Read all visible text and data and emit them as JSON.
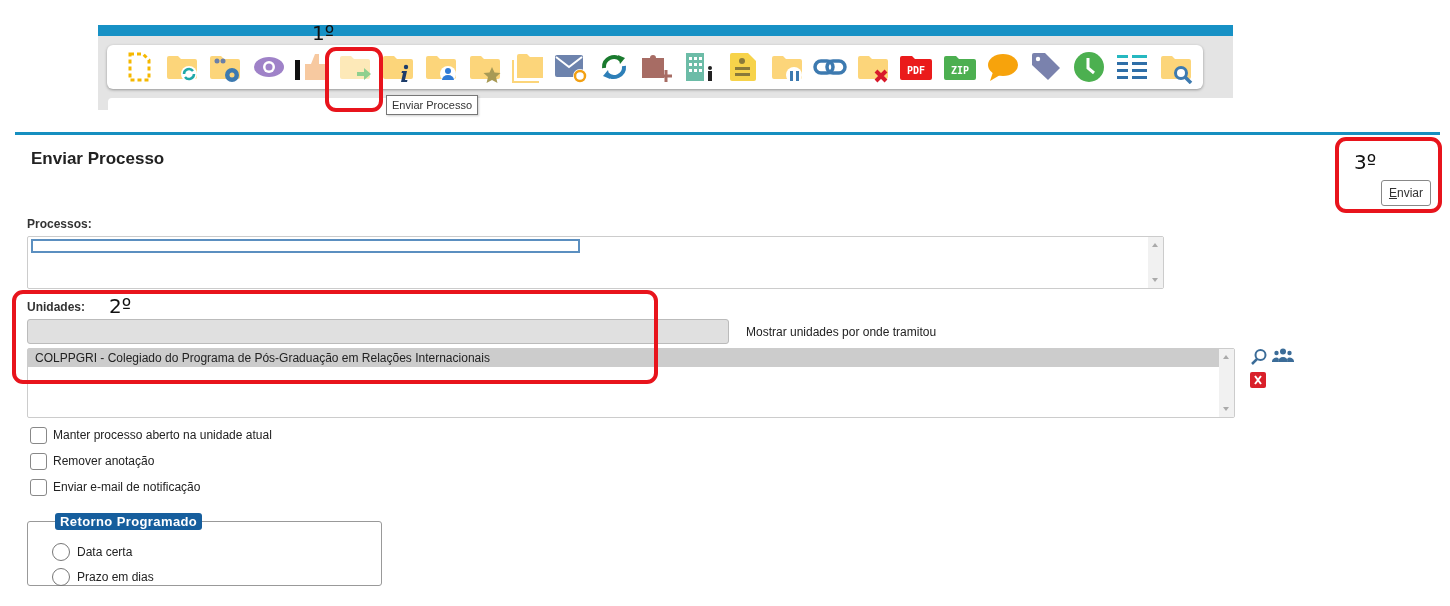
{
  "toolbar": {
    "pdf_label": "PDF",
    "zip_label": "ZIP",
    "tooltip": "Enviar Processo"
  },
  "page": {
    "title": "Enviar Processo",
    "submit_button": "Enviar"
  },
  "processos": {
    "label": "Processos:",
    "items": [
      {
        "selected": true
      }
    ]
  },
  "unidades": {
    "label": "Unidades:",
    "link": "Mostrar unidades por onde tramitou",
    "items": [
      {
        "text": "COLPPGRI - Colegiado do Programa de Pós-Graduação em Relações Internacionais",
        "selected": true
      }
    ]
  },
  "options": [
    {
      "label": "Manter processo aberto na unidade atual",
      "checked": false
    },
    {
      "label": "Remover anotação",
      "checked": false
    },
    {
      "label": "Enviar e-mail de notificação",
      "checked": false
    }
  ],
  "retorno": {
    "legend": "Retorno Programado",
    "choices": [
      {
        "label": "Data certa",
        "selected": false
      },
      {
        "label": "Prazo em dias",
        "selected": false
      }
    ]
  },
  "annotations": [
    {
      "label": "1º"
    },
    {
      "label": "2º"
    },
    {
      "label": "3º"
    }
  ]
}
